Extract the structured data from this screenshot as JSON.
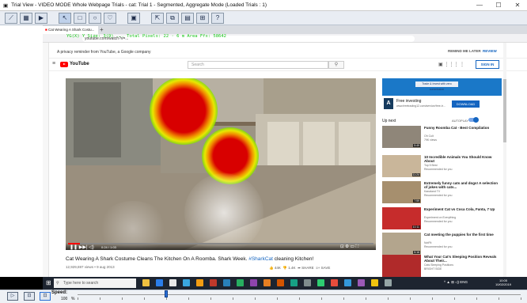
{
  "app": {
    "title": "Trial View - VIDEO MODE   Whole Webpage Trials - cat: Trial 1 - Segmented, Aggregate Mode (Loaded Trials : 1)",
    "window_controls": [
      "—",
      "☐",
      "✕"
    ]
  },
  "toolbar": {
    "icons": [
      "line-chart-icon",
      "image-icon",
      "video-icon",
      "pointer-icon",
      "rectangle-icon",
      "ellipse-icon",
      "heart-icon",
      "grid-icon",
      "export-icon",
      "copy-icon",
      "stats-icon",
      "snapshot-icon",
      "help-icon"
    ]
  },
  "browser": {
    "tab_label": "Cat Wearing A Shark Costu...",
    "tab_close": "✕",
    "tab_new": "+",
    "url": "youtube.com/watch?v=...",
    "gaze_overlay": "YG(X) Y Size: 3(9) ... Total Pixels: 22 · 6 m   Area Ffx: 58642"
  },
  "reminder": {
    "text": "A privacy reminder from YouTube, a Google company",
    "remind_later": "REMIND ME LATER",
    "review": "REVIEW"
  },
  "youtube": {
    "logo_text": "YouTube",
    "search_placeholder": "Search",
    "sign_in": "SIGN IN",
    "header_icons": "▣  ⋮⋮⋮  ⋮"
  },
  "video": {
    "time": "0:24 / 1:03",
    "title_plain": "Cat Wearing A Shark Costume Cleans The Kitchen On A Roomba. Shark Week. ",
    "title_tag": "#SharkCat",
    "title_rest": " cleaning Kitchen!",
    "meta": "12,929,697 views • 9 aug 2013",
    "likes": "44K",
    "dislikes": "1.4K",
    "share": "SHARE",
    "save": "SAVE",
    "progress": 0.04
  },
  "ad": {
    "banner_text": "Trade & Invest with zero commission",
    "title": "Free investing",
    "sub": "www.freetrading12.com/service/free-tr...",
    "button": "DOWNLOAD"
  },
  "sidebar": {
    "upnext": "Up next",
    "autoplay": "AUTOPLAY",
    "items": [
      {
        "title": "Funny Roomba Cat - Best Compilation",
        "channel": "Oh Cult",
        "views": "79K views",
        "duration": "5:49",
        "color": "#8f8679"
      },
      {
        "title": "10 Incredible Animals You Should Know About",
        "channel": "Top 5 Best",
        "views": "Recommended for you",
        "duration": "11:24",
        "color": "#c9b69a"
      },
      {
        "title": "Extremely funny cats and dogs! A selection of jokes with cats...",
        "channel": "Kanaland TV",
        "views": "Recommended for you",
        "duration": "7:59",
        "color": "#a68f6e"
      },
      {
        "title": "Experiment Cat vs Coca Cola, Fanta, 7 Up",
        "channel": "Experiment on Everything",
        "views": "Recommended for you",
        "duration": "10:11",
        "color": "#c62c2c"
      },
      {
        "title": "Cat meeting the puppies for the first time",
        "channel": "NotFit",
        "views": "Recommended for you",
        "duration": "5:16",
        "color": "#b3a58d"
      },
      {
        "title": "What Your Cat's Sleeping Position Reveals About Their...",
        "channel": "Cats Sleeping Positions",
        "views": "BRIGHT SIDE",
        "duration": "",
        "color": "#b02a2a"
      }
    ]
  },
  "taskbar": {
    "search_placeholder": "Type here to search",
    "tray": "^ ▲ ⊞ ◁) ENG",
    "clock_time": "10:05",
    "clock_date": "10/02/2019",
    "apps": [
      "#f0c040",
      "#2b7de9",
      "#e8e8e8",
      "#3aa7e0",
      "#f39c12",
      "#c0392b",
      "#2980b9",
      "#27ae60",
      "#8e44ad",
      "#e67e22",
      "#d35400",
      "#16a085",
      "#7f8c8d",
      "#2ecc71",
      "#e74c3c",
      "#3498db",
      "#9b59b6",
      "#f1c40f",
      "#95a5a6"
    ]
  },
  "playback": {
    "buttons": [
      "▷",
      "⊡",
      "⊡"
    ],
    "speed_label": "Speed:",
    "speed_value": "100",
    "speed_unit": "%",
    "speed_position": 0.2
  }
}
